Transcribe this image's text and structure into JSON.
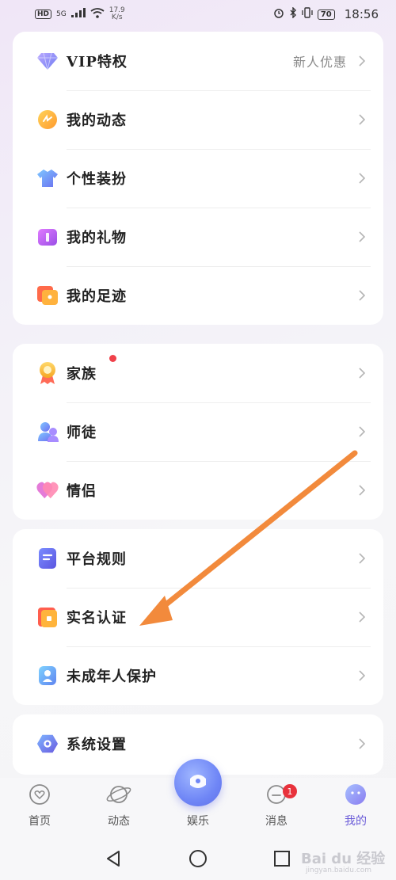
{
  "status_bar": {
    "hd": "HD",
    "network": "5G",
    "speed_value": "17.9",
    "speed_unit": "K/s",
    "battery": "70",
    "time": "18:56"
  },
  "card1": [
    {
      "label": "VIP特权",
      "hint": "新人优惠",
      "icon": "diamond-icon"
    },
    {
      "label": "我的动态",
      "icon": "moments-icon"
    },
    {
      "label": "个性装扮",
      "icon": "shirt-icon"
    },
    {
      "label": "我的礼物",
      "icon": "gift-icon"
    },
    {
      "label": "我的足迹",
      "icon": "footprint-icon"
    }
  ],
  "card2": [
    {
      "label": "家族",
      "icon": "family-medal-icon",
      "has_dot": true
    },
    {
      "label": "师徒",
      "icon": "mentor-icon"
    },
    {
      "label": "情侣",
      "icon": "couple-heart-icon"
    }
  ],
  "card3": [
    {
      "label": "平台规则",
      "icon": "rules-doc-icon"
    },
    {
      "label": "实名认证",
      "icon": "id-verify-icon"
    },
    {
      "label": "未成年人保护",
      "icon": "minor-protect-icon"
    }
  ],
  "card4": [
    {
      "label": "系统设置",
      "icon": "settings-icon"
    }
  ],
  "bottom_nav": {
    "items": [
      {
        "label": "首页",
        "icon": "home-heart-icon"
      },
      {
        "label": "动态",
        "icon": "planet-icon"
      },
      {
        "label": "娱乐",
        "icon": "entertainment-icon"
      },
      {
        "label": "消息",
        "icon": "message-icon",
        "badge": "1"
      },
      {
        "label": "我的",
        "icon": "profile-face-icon",
        "active": true
      }
    ]
  },
  "watermark": {
    "main": "Bai du 经验",
    "sub": "jingyan.baidu.com"
  },
  "colors": {
    "accent": "#6a5bd8",
    "badge_red": "#e8323c",
    "arrow_orange": "#f28a3c"
  }
}
